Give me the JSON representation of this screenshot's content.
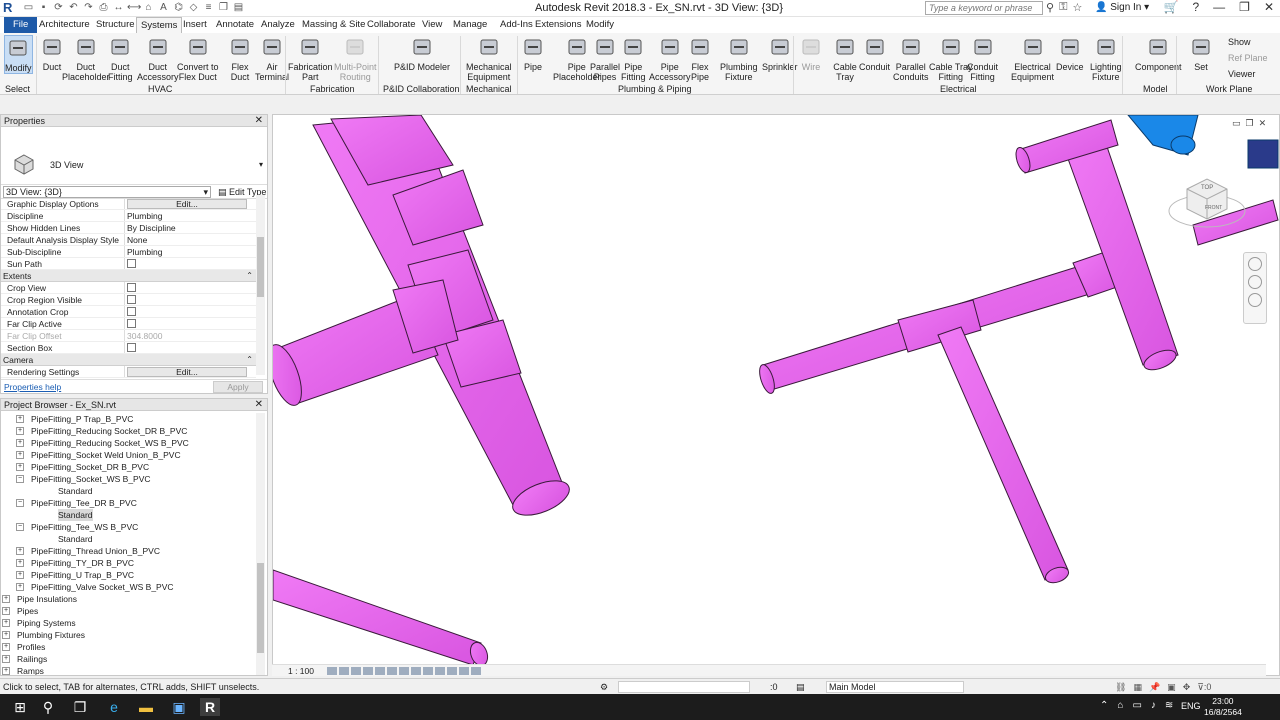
{
  "app": {
    "title": "Autodesk Revit 2018.3 -   Ex_SN.rvt - 3D View: {3D}",
    "search_placeholder": "Type a keyword or phrase",
    "sign_in": "Sign In"
  },
  "tabs": [
    "File",
    "Architecture",
    "Structure",
    "Systems",
    "Insert",
    "Annotate",
    "Analyze",
    "Massing & Site",
    "Collaborate",
    "View",
    "Manage",
    "Add-Ins",
    "Extensions",
    "Modify"
  ],
  "active_tab": "Systems",
  "ribbon": {
    "buttons": [
      {
        "label": "Modify",
        "icon": "cursor-icon"
      },
      {
        "label": "Duct",
        "icon": "duct-icon"
      },
      {
        "label": "Duct\nPlaceholder",
        "icon": "duct-placeholder-icon"
      },
      {
        "label": "Duct\nFitting",
        "icon": "duct-fitting-icon"
      },
      {
        "label": "Duct\nAccessory",
        "icon": "duct-accessory-icon"
      },
      {
        "label": "Convert to\nFlex Duct",
        "icon": "convert-flex-duct-icon"
      },
      {
        "label": "Flex\nDuct",
        "icon": "flex-duct-icon"
      },
      {
        "label": "Air\nTerminal",
        "icon": "air-terminal-icon"
      },
      {
        "label": "Fabrication\nPart",
        "icon": "fabrication-part-icon"
      },
      {
        "label": "Multi-Point\nRouting",
        "icon": "multipoint-routing-icon"
      },
      {
        "label": "P&ID Modeler",
        "icon": "pid-modeler-icon"
      },
      {
        "label": "Mechanical\nEquipment",
        "icon": "mechanical-equipment-icon"
      },
      {
        "label": "Pipe",
        "icon": "pipe-icon"
      },
      {
        "label": "Pipe\nPlaceholder",
        "icon": "pipe-placeholder-icon"
      },
      {
        "label": "Parallel\nPipes",
        "icon": "parallel-pipes-icon"
      },
      {
        "label": "Pipe\nFitting",
        "icon": "pipe-fitting-icon"
      },
      {
        "label": "Pipe\nAccessory",
        "icon": "pipe-accessory-icon"
      },
      {
        "label": "Flex\nPipe",
        "icon": "flex-pipe-icon"
      },
      {
        "label": "Plumbing\nFixture",
        "icon": "plumbing-fixture-icon"
      },
      {
        "label": "Sprinkler",
        "icon": "sprinkler-icon"
      },
      {
        "label": "Wire",
        "icon": "wire-icon"
      },
      {
        "label": "Cable\nTray",
        "icon": "cable-tray-icon"
      },
      {
        "label": "Conduit",
        "icon": "conduit-icon"
      },
      {
        "label": "Parallel\nConduits",
        "icon": "parallel-conduits-icon"
      },
      {
        "label": "Cable Tray\nFitting",
        "icon": "cable-tray-fitting-icon"
      },
      {
        "label": "Conduit\nFitting",
        "icon": "conduit-fitting-icon"
      },
      {
        "label": "Electrical\nEquipment",
        "icon": "electrical-equipment-icon"
      },
      {
        "label": "Device",
        "icon": "device-icon"
      },
      {
        "label": "Lighting\nFixture",
        "icon": "lighting-fixture-icon"
      },
      {
        "label": "Component",
        "icon": "component-icon"
      },
      {
        "label": "Set",
        "icon": "set-workplane-icon"
      }
    ],
    "small_buttons": [
      "Show",
      "Ref  Plane",
      "Viewer"
    ],
    "panels": [
      "Select",
      "HVAC",
      "Fabrication",
      "P&ID Collaboration",
      "Mechanical",
      "Plumbing & Piping",
      "Electrical",
      "Model",
      "Work Plane"
    ]
  },
  "properties": {
    "header": "Properties",
    "type_name": "3D View",
    "filter": "3D View: {3D}",
    "edit_type": "Edit Type",
    "rows": [
      {
        "k": "Graphic Display Options",
        "v": "Edit...",
        "kind": "button"
      },
      {
        "k": "Discipline",
        "v": "Plumbing"
      },
      {
        "k": "Show Hidden Lines",
        "v": "By Discipline"
      },
      {
        "k": "Default Analysis Display Style",
        "v": "None"
      },
      {
        "k": "Sub-Discipline",
        "v": "Plumbing"
      },
      {
        "k": "Sun Path",
        "v": "",
        "kind": "check"
      },
      {
        "k": "Extents",
        "kind": "group"
      },
      {
        "k": "Crop View",
        "v": "",
        "kind": "check"
      },
      {
        "k": "Crop Region Visible",
        "v": "",
        "kind": "check"
      },
      {
        "k": "Annotation Crop",
        "v": "",
        "kind": "check"
      },
      {
        "k": "Far Clip Active",
        "v": "",
        "kind": "check"
      },
      {
        "k": "Far Clip Offset",
        "v": "304.8000",
        "kind": "grey"
      },
      {
        "k": "Section Box",
        "v": "",
        "kind": "check"
      },
      {
        "k": "Camera",
        "kind": "group"
      },
      {
        "k": "Rendering Settings",
        "v": "Edit...",
        "kind": "button"
      }
    ],
    "help": "Properties help",
    "apply": "Apply"
  },
  "browser": {
    "header": "Project Browser - Ex_SN.rvt",
    "items": [
      {
        "label": "PipeFitting_P Trap_B_PVC",
        "lvl": 2,
        "exp": "+"
      },
      {
        "label": "PipeFitting_Reducing Socket_DR B_PVC",
        "lvl": 2,
        "exp": "+"
      },
      {
        "label": "PipeFitting_Reducing Socket_WS B_PVC",
        "lvl": 2,
        "exp": "+"
      },
      {
        "label": "PipeFitting_Socket Weld Union_B_PVC",
        "lvl": 2,
        "exp": "+"
      },
      {
        "label": "PipeFitting_Socket_DR B_PVC",
        "lvl": 2,
        "exp": "+"
      },
      {
        "label": "PipeFitting_Socket_WS B_PVC",
        "lvl": 2,
        "exp": "-"
      },
      {
        "label": "Standard",
        "lvl": 3
      },
      {
        "label": "PipeFitting_Tee_DR B_PVC",
        "lvl": 2,
        "exp": "-"
      },
      {
        "label": "Standard",
        "lvl": 3,
        "hl": true
      },
      {
        "label": "PipeFitting_Tee_WS B_PVC",
        "lvl": 2,
        "exp": "-"
      },
      {
        "label": "Standard",
        "lvl": 3
      },
      {
        "label": "PipeFitting_Thread Union_B_PVC",
        "lvl": 2,
        "exp": "+"
      },
      {
        "label": "PipeFitting_TY_DR B_PVC",
        "lvl": 2,
        "exp": "+"
      },
      {
        "label": "PipeFitting_U Trap_B_PVC",
        "lvl": 2,
        "exp": "+"
      },
      {
        "label": "PipeFitting_Valve Socket_WS B_PVC",
        "lvl": 2,
        "exp": "+"
      },
      {
        "label": "Pipe Insulations",
        "lvl": 1,
        "exp": "+"
      },
      {
        "label": "Pipes",
        "lvl": 1,
        "exp": "+"
      },
      {
        "label": "Piping Systems",
        "lvl": 1,
        "exp": "+"
      },
      {
        "label": "Plumbing Fixtures",
        "lvl": 1,
        "exp": "+"
      },
      {
        "label": "Profiles",
        "lvl": 1,
        "exp": "+"
      },
      {
        "label": "Railings",
        "lvl": 1,
        "exp": "+"
      },
      {
        "label": "Ramps",
        "lvl": 1,
        "exp": "+"
      }
    ]
  },
  "viewport": {
    "scale": "1 : 100",
    "viewcube_top": "TOP",
    "viewcube_front": "FRONT",
    "pipe_color": "#e86bf0",
    "pipe_edge": "#3a1a3a",
    "duct_color": "#1a88e8"
  },
  "status": {
    "message": "Click to select, TAB for alternates, CTRL adds, SHIFT unselects.",
    "zero": ":0",
    "model": "Main Model"
  },
  "taskbar": {
    "lang": "ENG",
    "time": "23:00",
    "date": "16/8/2564"
  }
}
